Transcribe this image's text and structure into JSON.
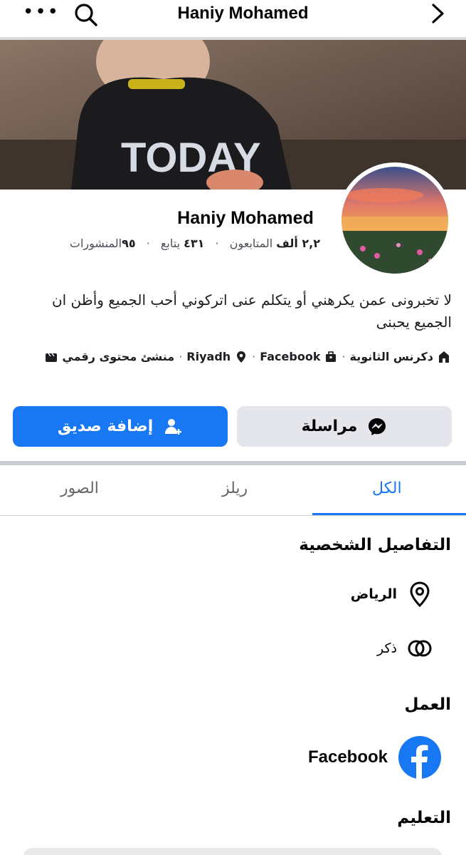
{
  "nav": {
    "title": "Haniy Mohamed",
    "more_icon": "more-horizontal-icon",
    "search_icon": "search-icon",
    "back_icon": "chevron-right-icon"
  },
  "profile": {
    "name": "Haniy Mohamed",
    "stats": {
      "followers_value": "٢,٢ ألف",
      "followers_label": "المتابعون",
      "following_value": "٤٣١",
      "following_label": "يتابع",
      "posts_value": "٩٥",
      "posts_label": "المنشورات"
    },
    "bio": "لا تخبرونى عمن يكرهني أو يتكلم عنى اتركوني أحب الجميع وأظن ان الجميع يحبنى",
    "meta": {
      "school": "دكرنس الثانوية",
      "workplace": "Facebook",
      "city": "Riyadh",
      "category": "منشئ محتوى رقمي"
    }
  },
  "actions": {
    "add_friend_label": "إضافة صديق",
    "message_label": "مراسلة",
    "brand_color": "#1877f2"
  },
  "tabs": [
    {
      "label": "الكل",
      "active": true
    },
    {
      "label": "ريلز",
      "active": false
    },
    {
      "label": "الصور",
      "active": false
    }
  ],
  "details": {
    "heading": "التفاصيل الشخصية",
    "location": "الرياض",
    "gender": "ذكر",
    "work_heading": "العمل",
    "work_place": "Facebook",
    "education_heading": "التعليم"
  }
}
